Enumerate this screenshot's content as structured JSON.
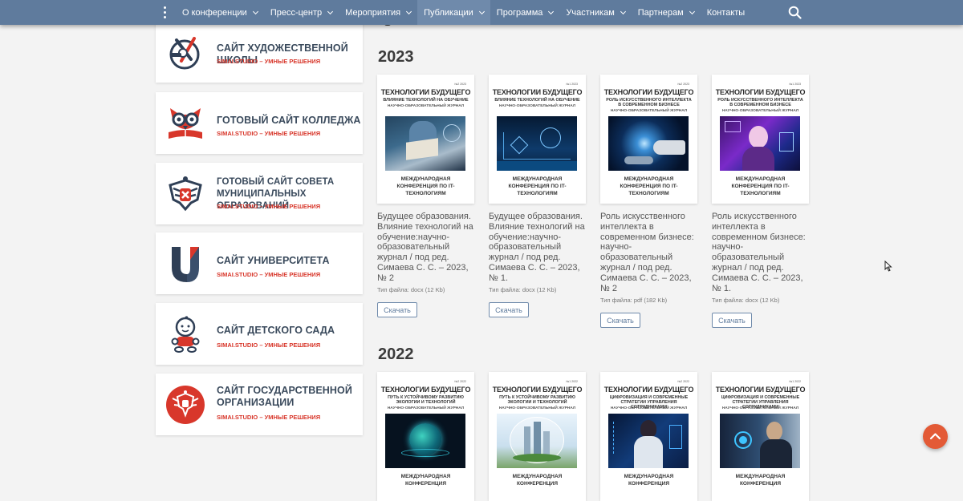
{
  "nav": {
    "items": [
      {
        "label": "О конференции",
        "dropdown": true
      },
      {
        "label": "Пресс-центр",
        "dropdown": true
      },
      {
        "label": "Мероприятия",
        "dropdown": true
      },
      {
        "label": "Публикации",
        "dropdown": true,
        "active": true
      },
      {
        "label": "Программа",
        "dropdown": true
      },
      {
        "label": "Участникам",
        "dropdown": true
      },
      {
        "label": "Партнерам",
        "dropdown": true
      },
      {
        "label": "Контакты",
        "dropdown": false
      }
    ],
    "menu_icon": "kebab-menu-icon",
    "search_icon": "search-icon",
    "color": "#5f7b9d"
  },
  "sidebar": {
    "brand_sub": "SIMAI.STUDIO – УМНЫЕ РЕШЕНИЯ",
    "cards": [
      {
        "title": "САЙТ ХУДОЖЕСТВЕННОЙ ШКОЛЫ",
        "icon": "art-school-icon"
      },
      {
        "title": "ГОТОВЫЙ САЙТ КОЛЛЕДЖА",
        "icon": "owl-college-icon"
      },
      {
        "title": "ГОТОВЫЙ САЙТ СОВЕТА МУНИЦИПАЛЬНЫХ ОБРАЗОВАНИЙ",
        "icon": "eagle-emblem-icon"
      },
      {
        "title": "САЙТ УНИВЕРСИТЕТА",
        "icon": "university-u-icon"
      },
      {
        "title": "САЙТ ДЕТСКОГО САДА",
        "icon": "kindergarten-child-icon"
      },
      {
        "title": "САЙТ ГОСУДАРСТВЕННОЙ ОРГАНИЗАЦИИ",
        "icon": "state-eagle-icon"
      }
    ]
  },
  "cover_common": {
    "title": "ТЕХНОЛОГИИ БУДУЩЕГО",
    "journal": "НАУЧНО-ОБРАЗОВАТЕЛЬНЫЙ ЖУРНАЛ",
    "conference": "МЕЖДУНАРОДНАЯ КОНФЕРЕНЦИЯ ПО IT-ТЕХНОЛОГИЯМ",
    "conference_cut": "МЕЖДУНАРОДНАЯ КОНФЕРЕНЦИЯ"
  },
  "download_label": "Скачать",
  "years": [
    {
      "year": "2023",
      "pubs": [
        {
          "cover_no": "№2 2023",
          "subtitle": "ВЛИЯНИЕ ТЕХНОЛОГИЙ НА ОБУЧЕНИЕ",
          "title": "Будущее образования. Влияние технологий на обучение:научно-образовательный журнал / под ред. Симаева С. С. – 2023, № 2",
          "ftype": "Тип файла: docx (12 Kb)"
        },
        {
          "cover_no": "№1 2023",
          "subtitle": "ВЛИЯНИЕ ТЕХНОЛОГИЙ НА ОБУЧЕНИЕ",
          "title": "Будущее образования. Влияние технологий на обучение:научно-образовательный журнал / под ред. Симаева С. С. – 2023, № 1.",
          "ftype": "Тип файла: docx (12 Kb)"
        },
        {
          "cover_no": "№2 2023",
          "subtitle": "РОЛЬ ИСКУССТВЕННОГО ИНТЕЛЛЕКТА В СОВРЕМЕННОМ БИЗНЕСЕ",
          "title": "Роль искусственного интеллекта в современном бизнесе: научно-образовательный журнал / под ред. Симаева С. С. – 2023, № 2",
          "ftype": "Тип файла: pdf (182 Kb)"
        },
        {
          "cover_no": "№1 2023",
          "subtitle": "РОЛЬ ИСКУССТВЕННОГО ИНТЕЛЛЕКТА В СОВРЕМЕННОМ БИЗНЕСЕ",
          "title": "Роль искусственного интеллекта в современном бизнесе: научно-образовательный журнал / под ред. Симаева С. С. – 2023, № 1.",
          "ftype": "Тип файла: docx (12 Kb)"
        }
      ]
    },
    {
      "year": "2022",
      "pubs": [
        {
          "cover_no": "№2 2022",
          "subtitle": "ПУТЬ К УСТОЙЧИВОМУ РАЗВИТИЮ ЭКОЛОГИИ И ТЕХНОЛОГИЙ"
        },
        {
          "cover_no": "№1 2022",
          "subtitle": "ПУТЬ К УСТОЙЧИВОМУ РАЗВИТИЮ ЭКОЛОГИИ И ТЕХНОЛОГИЙ"
        },
        {
          "cover_no": "№2 2022",
          "subtitle": "ЦИФРОВИЗАЦИЯ И СОВРЕМЕННЫЕ СТРАТЕГИИ УПРАВЛЕНИЯ СОТРУДНИКАМИ"
        },
        {
          "cover_no": "№1 2022",
          "subtitle": "ЦИФРОВИЗАЦИЯ И СОВРЕМЕННЫЕ СТРАТЕГИИ УПРАВЛЕНИЯ СОТРУДНИКАМИ"
        }
      ]
    }
  ],
  "scroll_top_icon": "arrow-up-icon",
  "accent": "#e35a36"
}
